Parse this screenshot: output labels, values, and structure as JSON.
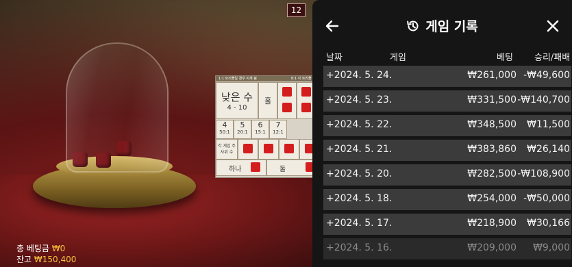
{
  "game": {
    "dealer_badge": "12",
    "board": {
      "small_label": "낮은 수",
      "small_range": "4 - 10",
      "odd_label": "홀",
      "pair_label": "하나",
      "even_label": "둘",
      "header_left": "1:1 트리플일 경우 지게 됨",
      "header_right": "8:1 각 트리플",
      "totals": [
        "4",
        "5",
        "6",
        "7"
      ],
      "payouts": [
        "50:1",
        "20:1",
        "15:1",
        "12:1"
      ],
      "any_label": "각 게임 주사위 수"
    },
    "total_bet_label": "총 베팅금",
    "total_bet_value": "₩0",
    "balance_label": "잔고",
    "balance_value": "₩150,400"
  },
  "panel": {
    "title": "게임 기록",
    "columns": {
      "date": "날짜",
      "game": "게임",
      "bet": "베팅",
      "result": "승리/패배"
    },
    "rows": [
      {
        "date": "+2024. 5. 24.",
        "bet": "₩261,000",
        "result": "-₩49,600"
      },
      {
        "date": "+2024. 5. 23.",
        "bet": "₩331,500",
        "result": "-₩140,700"
      },
      {
        "date": "+2024. 5. 22.",
        "bet": "₩348,500",
        "result": "₩11,500"
      },
      {
        "date": "+2024. 5. 21.",
        "bet": "₩383,860",
        "result": "₩26,140"
      },
      {
        "date": "+2024. 5. 20.",
        "bet": "₩282,500",
        "result": "-₩108,900"
      },
      {
        "date": "+2024. 5. 18.",
        "bet": "₩254,000",
        "result": "-₩50,000"
      },
      {
        "date": "+2024. 5. 17.",
        "bet": "₩218,900",
        "result": "₩30,166"
      },
      {
        "date": "+2024. 5. 16.",
        "bet": "₩209,000",
        "result": "₩9,000"
      }
    ]
  },
  "icons": {
    "back": "arrow-left-icon",
    "history": "history-icon",
    "close": "close-icon"
  }
}
